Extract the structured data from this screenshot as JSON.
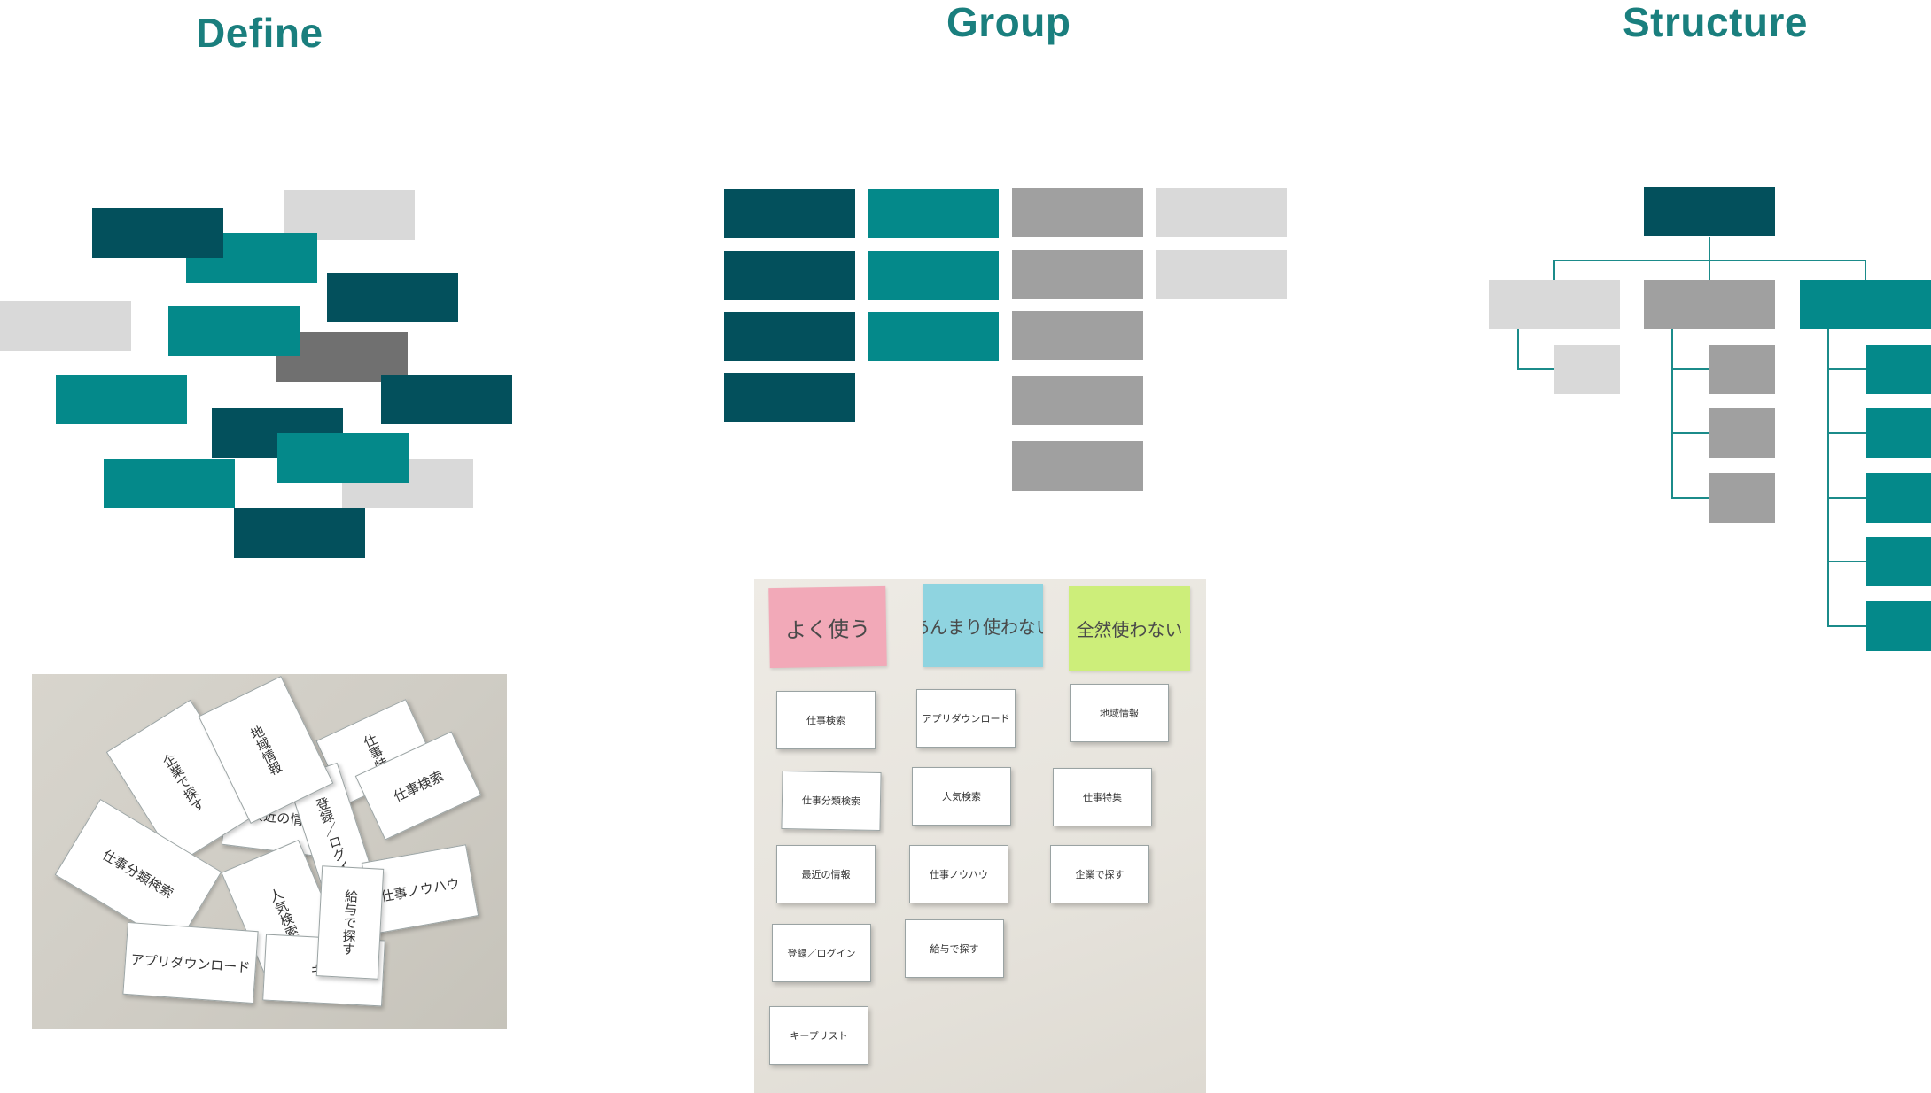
{
  "headings": {
    "define": "Define",
    "group": "Group",
    "structure": "Structure"
  },
  "colors": {
    "dark": "#03505c",
    "teal": "#04898a",
    "grey": "#a0a0a0",
    "dark_grey": "#707070",
    "light": "#d9d9d9",
    "heading": "#1a7f7e"
  },
  "photo_define": {
    "cards": [
      "企業で探す",
      "地域情報",
      "仕事特",
      "仕事検索",
      "登録／ログイン",
      "最近の情報",
      "仕事分類検索",
      "人気検索",
      "仕事ノウハウ",
      "給与で探す",
      "アプリダウンロード",
      "キー"
    ]
  },
  "photo_group": {
    "stickies": [
      "よく使う",
      "あんまり使わない",
      "全然使わない"
    ],
    "cards": [
      "仕事検索",
      "アプリダウンロード",
      "地域情報",
      "仕事分類検索",
      "人気検索",
      "仕事特集",
      "最近の情報",
      "仕事ノウハウ",
      "企業で探す",
      "登録／ログイン",
      "給与で探す",
      "キープリスト"
    ]
  }
}
